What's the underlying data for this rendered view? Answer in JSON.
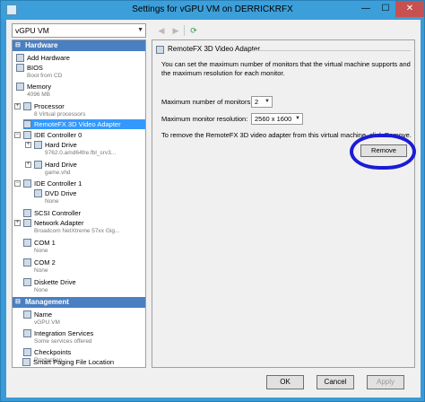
{
  "window": {
    "title": "Settings for vGPU VM on DERRICKRFX",
    "minimize_glyph": "—",
    "maximize_glyph": "☐",
    "close_glyph": "✕"
  },
  "vm_selector": {
    "value": "vGPU VM"
  },
  "nav": {
    "back_glyph": "◀",
    "forward_glyph": "▶",
    "refresh_glyph": "⟳"
  },
  "tree": {
    "hardware_header": "Hardware",
    "management_header": "Management",
    "collapse_glyph": "⊟",
    "hardware": [
      {
        "label": "Add Hardware",
        "sub": ""
      },
      {
        "label": "BIOS",
        "sub": "Boot from CD"
      },
      {
        "label": "Memory",
        "sub": "4096 MB"
      },
      {
        "label": "Processor",
        "sub": "8 Virtual processors"
      },
      {
        "label": "RemoteFX 3D Video Adapter",
        "sub": ""
      },
      {
        "label": "IDE Controller 0",
        "sub": ""
      },
      {
        "label": "Hard Drive",
        "sub": "9762.0.amd64fre.fbl_srv3..."
      },
      {
        "label": "Hard Drive",
        "sub": "game.vhd"
      },
      {
        "label": "IDE Controller 1",
        "sub": ""
      },
      {
        "label": "DVD Drive",
        "sub": "None"
      },
      {
        "label": "SCSI Controller",
        "sub": ""
      },
      {
        "label": "Network Adapter",
        "sub": "Broadcom NetXtreme 57xx Gig..."
      },
      {
        "label": "COM 1",
        "sub": "None"
      },
      {
        "label": "COM 2",
        "sub": "None"
      },
      {
        "label": "Diskette Drive",
        "sub": "None"
      }
    ],
    "management": [
      {
        "label": "Name",
        "sub": "vGPU VM"
      },
      {
        "label": "Integration Services",
        "sub": "Some services offered"
      },
      {
        "label": "Checkpoints",
        "sub": "Production"
      },
      {
        "label": "Smart Paging File Location",
        "sub": ""
      }
    ]
  },
  "panel": {
    "title": "RemoteFX 3D Video Adapter",
    "description": "You can set the maximum number of monitors that the virtual machine supports and the maximum resolution for each monitor.",
    "monitors_label": "Maximum number of monitors:",
    "monitors_value": "2",
    "resolution_label": "Maximum monitor resolution:",
    "resolution_value": "2560 x 1600",
    "remove_text": "To remove the RemoteFX 3D video adapter from this virtual machine, click Remove.",
    "remove_label": "Remove"
  },
  "footer": {
    "ok": "OK",
    "cancel": "Cancel",
    "apply": "Apply"
  },
  "colors": {
    "titlebar": "#3c9fd9",
    "selection": "#3399ff",
    "section_header": "#4a7fc1",
    "annotation": "#1b1bd6"
  }
}
